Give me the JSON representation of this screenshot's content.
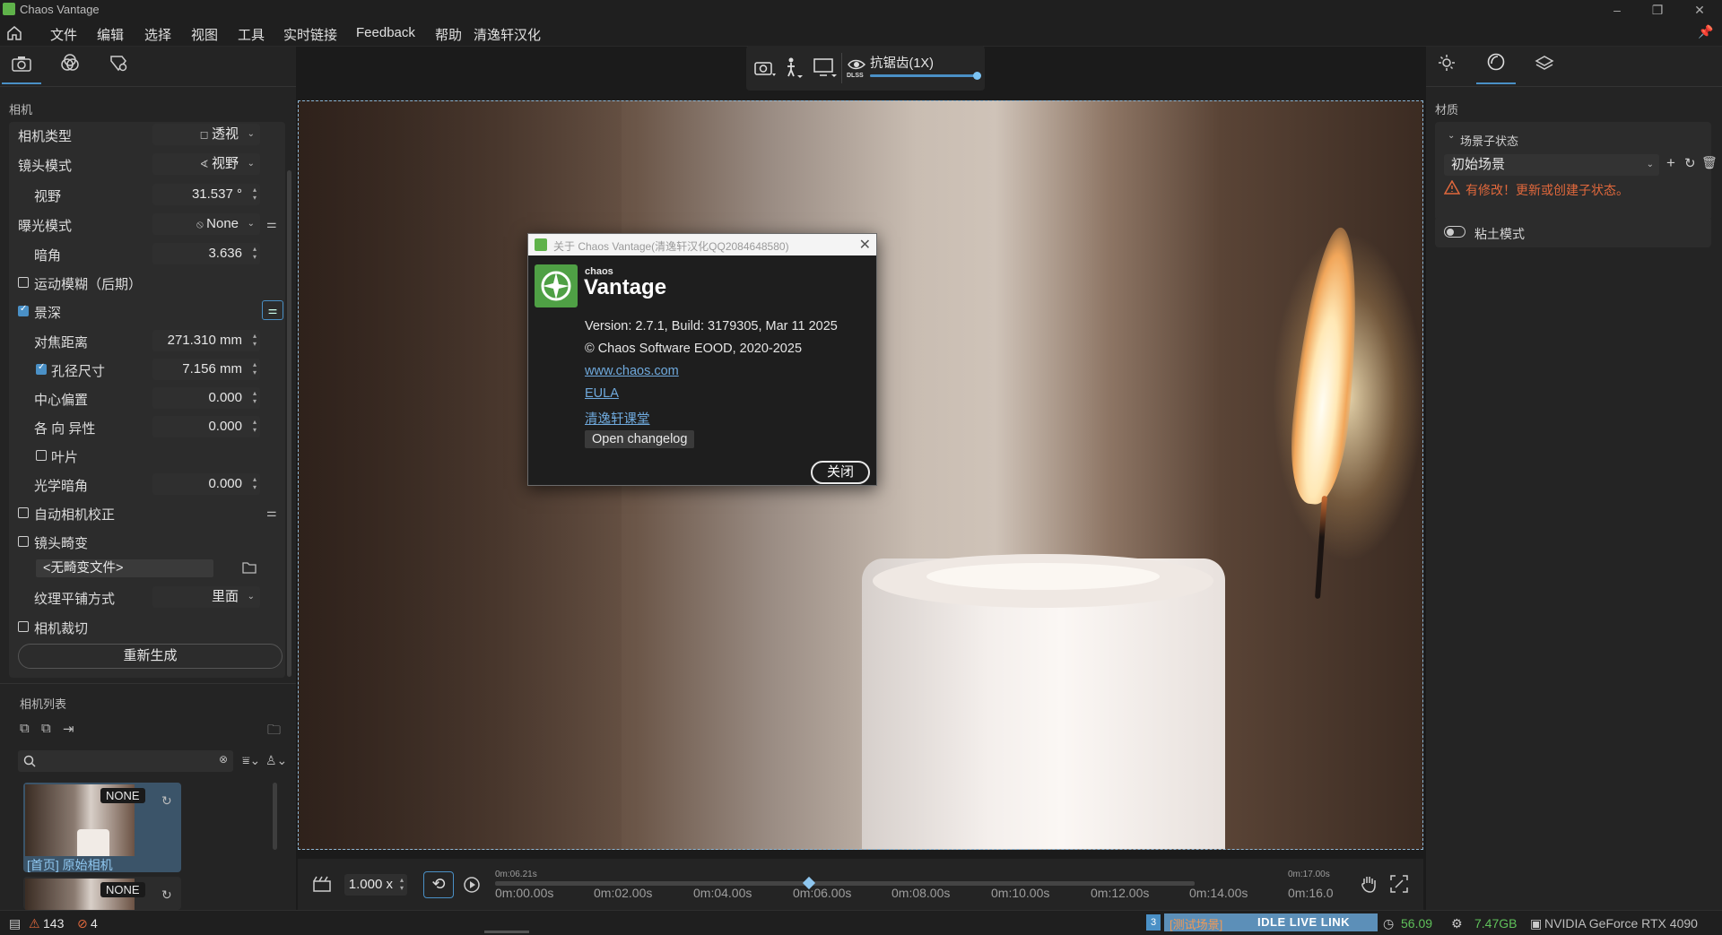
{
  "window": {
    "title": "Chaos Vantage",
    "min": "–",
    "restore": "❐",
    "close": "✕"
  },
  "menu": [
    "文件",
    "编辑",
    "选择",
    "视图",
    "工具",
    "实时链接",
    "Feedback",
    "帮助",
    "清逸轩汉化"
  ],
  "left": {
    "section_title": "相机",
    "props": {
      "camera_type": {
        "label": "相机类型",
        "value": "透视"
      },
      "lens_mode": {
        "label": "镜头模式",
        "value": "视野"
      },
      "fov": {
        "label": "视野",
        "value": "31.537 °"
      },
      "exposure": {
        "label": "曝光模式",
        "value": "None"
      },
      "vignette": {
        "label": "暗角",
        "value": "3.636"
      },
      "motion_blur": {
        "label": "运动模糊（后期）"
      },
      "dof": {
        "label": "景深"
      },
      "focus_dist": {
        "label": "对焦距离",
        "value": "271.310 mm"
      },
      "aperture": {
        "label": "孔径尺寸",
        "value": "7.156 mm"
      },
      "center_bias": {
        "label": "中心偏置",
        "value": "0.000"
      },
      "anisotropy": {
        "label": "各 向 异性",
        "value": "0.000"
      },
      "blades": {
        "label": "叶片"
      },
      "optical_vignette": {
        "label": "光学暗角",
        "value": "0.000"
      },
      "auto_correct": {
        "label": "自动相机校正"
      },
      "lens_distortion": {
        "label": "镜头畸变"
      },
      "distortion_file": {
        "value": "<无畸变文件>"
      },
      "texture_tiling": {
        "label": "纹理平铺方式",
        "value": "里面"
      },
      "crop": {
        "label": "相机裁切"
      }
    },
    "regenerate": "重新生成",
    "camera_list_title": "相机列表",
    "cameras": [
      {
        "badge": "NONE",
        "name": "[首页] 原始相机"
      },
      {
        "badge": "NONE",
        "name": ""
      }
    ]
  },
  "viewport_bar": {
    "aa_label": "抗锯齿(1X)",
    "aa_fraction": 1.0,
    "dlss": "DLSS"
  },
  "about": {
    "title": "关于 Chaos Vantage(清逸轩汉化QQ2084648580)",
    "brand_small": "chaos",
    "brand": "Vantage",
    "version": "Version: 2.7.1, Build: 3179305, Mar 11 2025",
    "copyright": "© Chaos Software EOOD, 2020-2025",
    "link1": "www.chaos.com",
    "link2": "EULA",
    "link3": "清逸轩课堂",
    "changelog": "Open changelog",
    "close": "关闭"
  },
  "right": {
    "section_title": "材质",
    "scene_states_title": "场景子状态",
    "scene_state_value": "初始场景",
    "warning": "有修改！更新或创建子状态。",
    "clay_mode": "粘土模式"
  },
  "timeline": {
    "speed": "1.000 x",
    "start_time": "0m:06.21s",
    "end_time": "0m:17.00s",
    "ticks": [
      "0m:00.00s",
      "0m:02.00s",
      "0m:04.00s",
      "0m:06.00s",
      "0m:08.00s",
      "0m:10.00s",
      "0m:12.00s",
      "0m:14.00s",
      "0m:16.0"
    ]
  },
  "status": {
    "warnings": "143",
    "errors": "4",
    "queue": "3",
    "link_mode": "[测试场景]",
    "live_link": "IDLE LIVE LINK",
    "fps": "56.09",
    "vram": "7.47GB",
    "gpu": "NVIDIA GeForce RTX 4090"
  }
}
